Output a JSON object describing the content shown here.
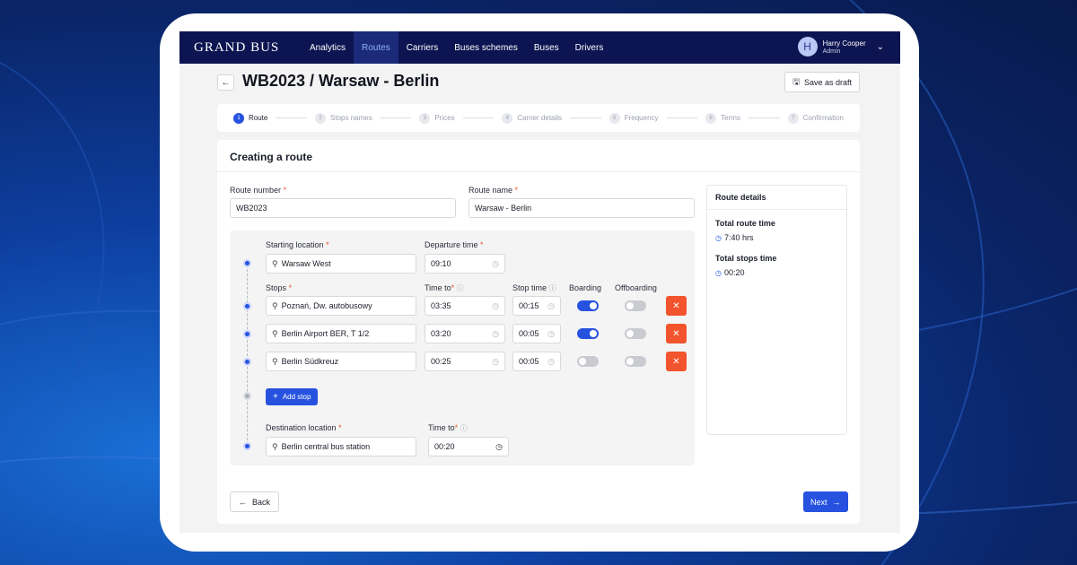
{
  "brand": {
    "logo": "GRAND BUS"
  },
  "nav": {
    "items": [
      "Analytics",
      "Routes",
      "Carriers",
      "Buses schemes",
      "Buses",
      "Drivers"
    ],
    "active": "Routes"
  },
  "user": {
    "initial": "H",
    "name": "Harry Cooper",
    "role": "Admin"
  },
  "header": {
    "title": "WB2023 / Warsaw - Berlin",
    "save_draft_label": "Save as draft"
  },
  "stepper": {
    "steps": [
      {
        "num": "1",
        "label": "Route"
      },
      {
        "num": "2",
        "label": "Stops names"
      },
      {
        "num": "3",
        "label": "Prices"
      },
      {
        "num": "4",
        "label": "Carrier details"
      },
      {
        "num": "5",
        "label": "Frequency"
      },
      {
        "num": "6",
        "label": "Terms"
      },
      {
        "num": "7",
        "label": "Confirmation"
      }
    ],
    "active_step": "1"
  },
  "form": {
    "card_title": "Creating a route",
    "route_number_label": "Route number",
    "route_number_value": "WB2023",
    "route_name_label": "Route name",
    "route_name_value": "Warsaw - Berlin",
    "starting_location_label": "Starting location",
    "starting_location_value": "Warsaw West",
    "departure_time_label": "Departure time",
    "departure_time_value": "09:10",
    "stops_label": "Stops",
    "time_to_label": "Time to",
    "stop_time_label": "Stop time",
    "boarding_label": "Boarding",
    "offboarding_label": "Offboarding",
    "stops": [
      {
        "name": "Poznań, Dw. autobusowy",
        "time_to": "03:35",
        "stop_time": "00:15",
        "boarding": true,
        "offboarding": false
      },
      {
        "name": "Berlin Airport BER, T 1/2",
        "time_to": "03:20",
        "stop_time": "00:05",
        "boarding": true,
        "offboarding": false
      },
      {
        "name": "Berlin Südkreuz",
        "time_to": "00:25",
        "stop_time": "00:05",
        "boarding": false,
        "offboarding": false
      }
    ],
    "add_stop_label": "Add stop",
    "destination_label": "Destination location",
    "destination_value": "Berlin central bus station",
    "destination_time_to_label": "Time to",
    "destination_time_to_value": "00:20",
    "required_mark": "*"
  },
  "route_details": {
    "title": "Route details",
    "total_route_time_label": "Total route time",
    "total_route_time_value": "7:40 hrs",
    "total_stops_time_label": "Total stops time",
    "total_stops_time_value": "00:20"
  },
  "footer": {
    "back_label": "Back",
    "next_label": "Next"
  },
  "icons": {
    "back": "arrow-left-icon",
    "search": "search-icon",
    "clock": "clock-icon",
    "info": "info-icon",
    "save": "save-icon",
    "close": "close-icon",
    "plus": "plus-icon",
    "next": "arrow-right-icon",
    "chevron": "chevron-down-icon"
  },
  "colors": {
    "nav_bg": "#0c1551",
    "accent": "#2752e0",
    "danger": "#f2542d",
    "background": "#0a2a7a"
  }
}
